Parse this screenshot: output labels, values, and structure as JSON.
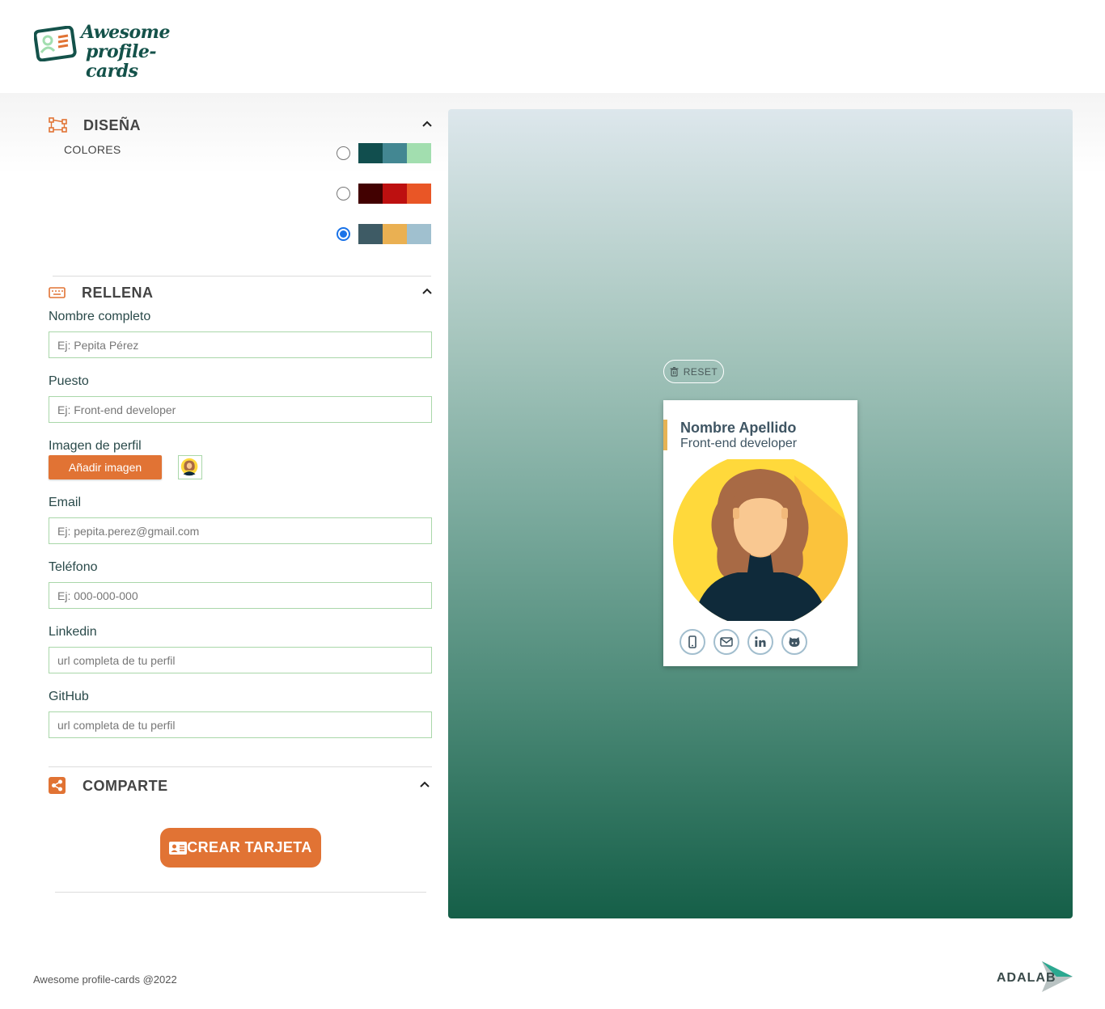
{
  "header": {
    "logo_line1": "Awesome",
    "logo_line2": "profile-cards"
  },
  "design": {
    "title": "DISEÑA",
    "colors_label": "COLORES",
    "palettes": [
      {
        "selected": false,
        "colors": [
          "#114e4e",
          "#438792",
          "#a2deaf"
        ]
      },
      {
        "selected": false,
        "colors": [
          "#420101",
          "#bd1010",
          "#e95626"
        ]
      },
      {
        "selected": true,
        "colors": [
          "#3e5b65",
          "#eab052",
          "#a0c0cf"
        ]
      }
    ]
  },
  "fill": {
    "title": "RELLENA",
    "fields": {
      "name": {
        "label": "Nombre completo",
        "placeholder": "Ej: Pepita Pérez"
      },
      "job": {
        "label": "Puesto",
        "placeholder": "Ej: Front-end developer"
      },
      "image": {
        "label": "Imagen de perfil",
        "button": "Añadir imagen"
      },
      "email": {
        "label": "Email",
        "placeholder": "Ej: pepita.perez@gmail.com"
      },
      "phone": {
        "label": "Teléfono",
        "placeholder": "Ej: 000-000-000"
      },
      "linkedin": {
        "label": "Linkedin",
        "placeholder": "url completa de tu perfil"
      },
      "github": {
        "label": "GitHub",
        "placeholder": "url completa de tu perfil"
      }
    }
  },
  "share": {
    "title": "COMPARTE",
    "create_button": "CREAR TARJETA"
  },
  "preview": {
    "reset_label": "RESET",
    "card": {
      "name": "Nombre Apellido",
      "job": "Front-end developer",
      "social_icons": [
        "phone-icon",
        "email-icon",
        "linkedin-icon",
        "github-icon"
      ]
    }
  },
  "footer": {
    "copyright": "Awesome profile-cards @2022",
    "brand": "ADALAB"
  },
  "colors": {
    "accent_orange": "#e17334",
    "card_text": "#3f5563",
    "input_border": "#a9d7a9"
  }
}
